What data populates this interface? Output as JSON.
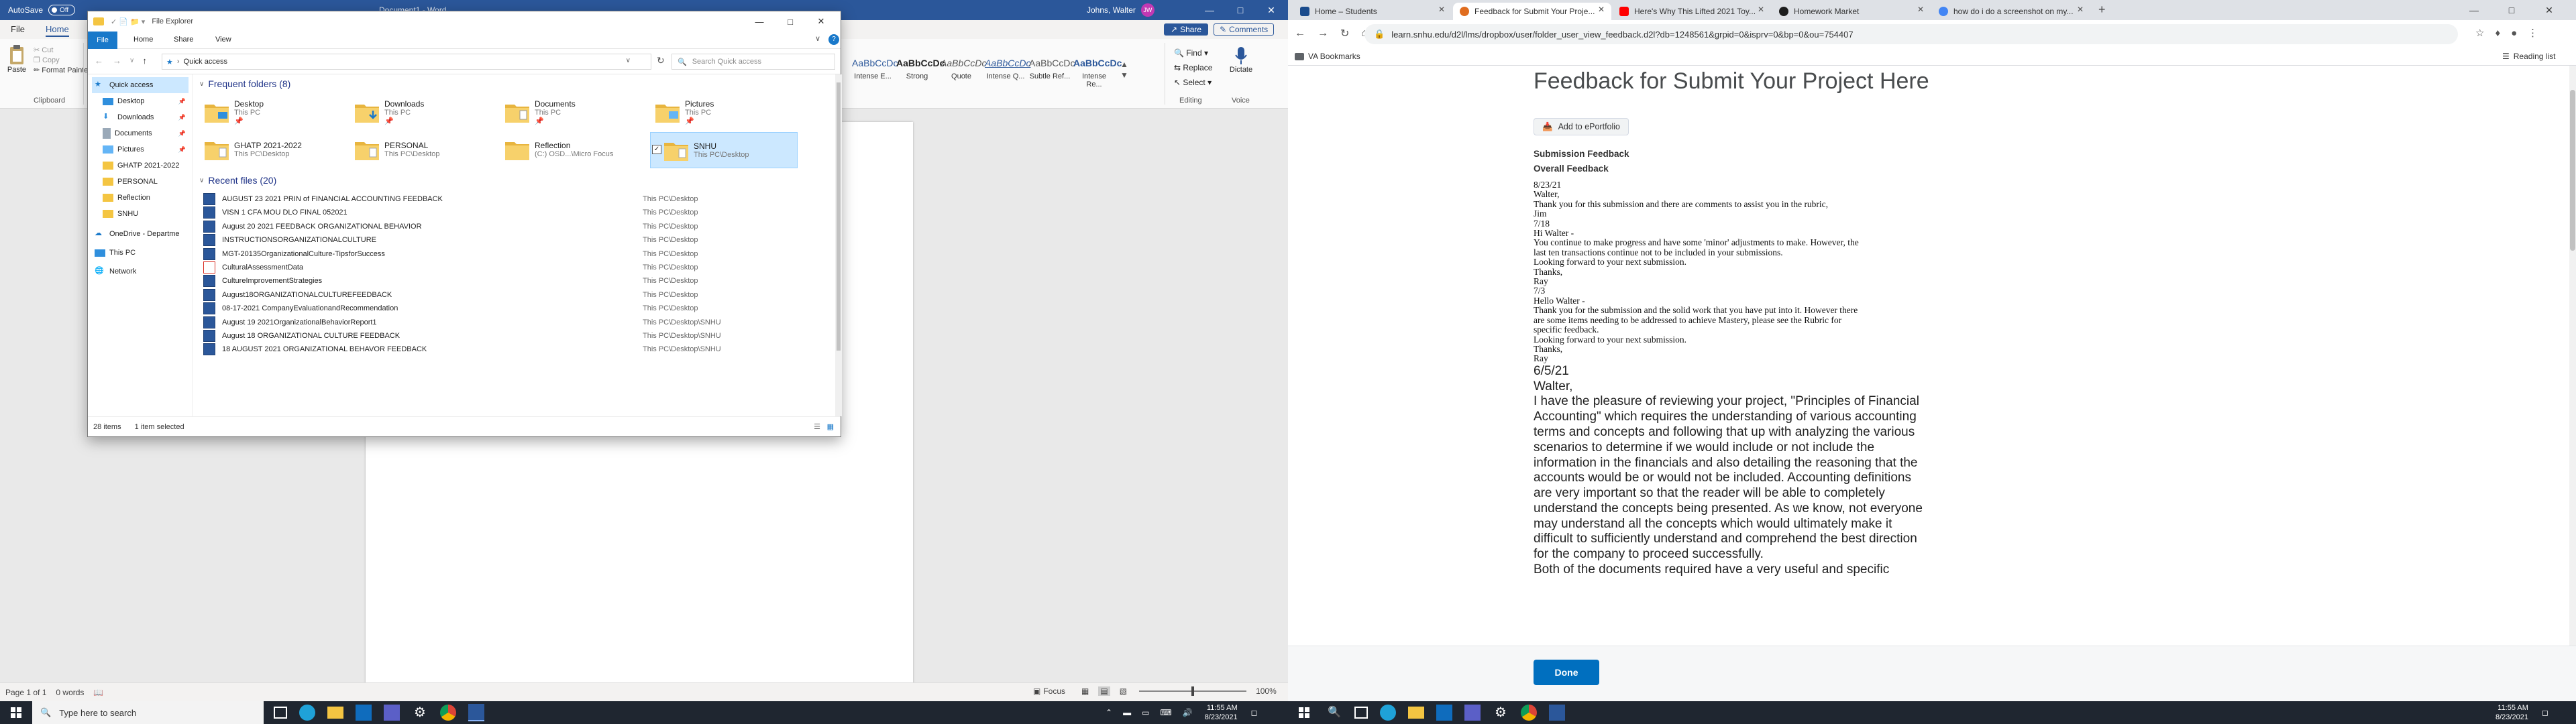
{
  "word": {
    "autosave_label": "AutoSave",
    "autosave_state": "Off",
    "doc_title": "Document1 - Word",
    "user_name": "Johns, Walter",
    "user_initials": "JW",
    "tabs": [
      "File",
      "Home"
    ],
    "share_label": "Share",
    "comments_label": "Comments",
    "clipboard": {
      "paste": "Paste",
      "cut": "Cut",
      "copy": "Copy",
      "format_painter": "Format Painter",
      "group": "Clipboard"
    },
    "styles": [
      {
        "sample": "AaBbCcDc",
        "name": "Intense E..."
      },
      {
        "sample": "AaBbCcDc",
        "name": "Strong"
      },
      {
        "sample": "AaBbCcDc",
        "name": "Quote"
      },
      {
        "sample": "AaBbCcDc",
        "name": "Intense Q..."
      },
      {
        "sample": "AaBbCcDc",
        "name": "Subtle Ref..."
      },
      {
        "sample": "AaBbCcDc",
        "name": "Intense Re..."
      }
    ],
    "editing": {
      "find": "Find",
      "replace": "Replace",
      "select": "Select",
      "group": "Editing"
    },
    "voice": {
      "dictate": "Dictate",
      "group": "Voice"
    },
    "status_page": "Page 1 of 1",
    "status_words": "0 words",
    "status_focus": "Focus",
    "status_zoom": "100%"
  },
  "explorer": {
    "title": "File Explorer",
    "ribbon_tabs": [
      "File",
      "Home",
      "Share",
      "View"
    ],
    "address": "Quick access",
    "search_placeholder": "Search Quick access",
    "sidebar": [
      {
        "label": "Quick access",
        "icon": "star-icon"
      },
      {
        "label": "Desktop",
        "icon": "desktop-icon"
      },
      {
        "label": "Downloads",
        "icon": "download-icon"
      },
      {
        "label": "Documents",
        "icon": "document-icon"
      },
      {
        "label": "Pictures",
        "icon": "picture-icon"
      },
      {
        "label": "GHATP 2021-2022",
        "icon": "folder-icon"
      },
      {
        "label": "PERSONAL",
        "icon": "folder-icon"
      },
      {
        "label": "Reflection",
        "icon": "folder-icon"
      },
      {
        "label": "SNHU",
        "icon": "folder-icon"
      },
      {
        "label": "OneDrive - Departme",
        "icon": "cloud-icon"
      },
      {
        "label": "This PC",
        "icon": "pc-icon"
      },
      {
        "label": "Network",
        "icon": "network-icon"
      }
    ],
    "frequent_header": "Frequent folders (8)",
    "frequent": [
      {
        "name": "Desktop",
        "path": "This PC"
      },
      {
        "name": "Downloads",
        "path": "This PC"
      },
      {
        "name": "Documents",
        "path": "This PC"
      },
      {
        "name": "Pictures",
        "path": "This PC"
      },
      {
        "name": "GHATP 2021-2022",
        "path": "This PC\\Desktop"
      },
      {
        "name": "PERSONAL",
        "path": "This PC\\Desktop"
      },
      {
        "name": "Reflection",
        "path": "(C:) OSD...\\Micro Focus"
      },
      {
        "name": "SNHU",
        "path": "This PC\\Desktop"
      }
    ],
    "recent_header": "Recent files (20)",
    "recent": [
      {
        "name": "AUGUST 23 2021 PRIN of FINANCIAL ACCOUNTING FEEDBACK",
        "loc": "This PC\\Desktop",
        "type": "word"
      },
      {
        "name": "VISN 1 CFA MOU DLO FINAL 052021",
        "loc": "This PC\\Desktop",
        "type": "word"
      },
      {
        "name": "August 20 2021 FEEDBACK ORGANIZATIONAL BEHAVIOR",
        "loc": "This PC\\Desktop",
        "type": "word"
      },
      {
        "name": "INSTRUCTIONSORGANIZATIONALCULTURE",
        "loc": "This PC\\Desktop",
        "type": "word"
      },
      {
        "name": "MGT-20135OrganizationalCulture-TipsforSuccess",
        "loc": "This PC\\Desktop",
        "type": "word"
      },
      {
        "name": "CulturalAssessmentData",
        "loc": "This PC\\Desktop",
        "type": "pdf"
      },
      {
        "name": "CultureImprovementStrategies",
        "loc": "This PC\\Desktop",
        "type": "word"
      },
      {
        "name": "August18ORGANIZATIONALCULTUREFEEDBACK",
        "loc": "This PC\\Desktop",
        "type": "word"
      },
      {
        "name": "08-17-2021 CompanyEvaluationandRecommendation",
        "loc": "This PC\\Desktop",
        "type": "word"
      },
      {
        "name": "August 19 2021OrganizationalBehaviorReport1",
        "loc": "This PC\\Desktop\\SNHU",
        "type": "word"
      },
      {
        "name": "August 18 ORGANIZATIONAL CULTURE FEEDBACK",
        "loc": "This PC\\Desktop\\SNHU",
        "type": "word"
      },
      {
        "name": "18 AUGUST 2021 ORGANIZATIONAL BEHAVOR FEEDBACK",
        "loc": "This PC\\Desktop\\SNHU",
        "type": "word"
      }
    ],
    "status_items": "28 items",
    "status_selected": "1 item selected"
  },
  "taskbar": {
    "search_placeholder": "Type here to search",
    "time": "11:55 AM",
    "date": "8/23/2021"
  },
  "chrome": {
    "tabs": [
      {
        "title": "Home – Students",
        "color": "#1a4b8c"
      },
      {
        "title": "Feedback for Submit Your Proje...",
        "color": "#e06d1f"
      },
      {
        "title": "Here's Why This Lifted 2021 Toy...",
        "color": "#ff0000"
      },
      {
        "title": "Homework Market",
        "color": "#1d1d1d"
      },
      {
        "title": "how do i do a screenshot on my...",
        "color": "#4285f4"
      }
    ],
    "url": "learn.snhu.edu/d2l/lms/dropbox/user/folder_user_view_feedback.d2l?db=1248561&grpid=0&isprv=0&bp=0&ou=754407",
    "bookmark_folder": "VA Bookmarks",
    "reading_list": "Reading list",
    "page_title": "Feedback for Submit Your Project Here",
    "eportfolio_button": "Add to ePortfolio",
    "submission_feedback": "Submission Feedback",
    "overall_feedback": "Overall Feedback",
    "feedback_small": [
      "8/23/21",
      "Walter,",
      "Thank you for this submission and there are comments to assist you in the rubric,",
      "Jim",
      "7/18",
      "Hi Walter -",
      "You continue to make progress and have some 'minor' adjustments to make.  However, the",
      "last ten transactions continue not to be included in your submissions.",
      "Looking forward to your next submission.",
      "Thanks,",
      "Ray",
      "7/3",
      "Hello Walter -",
      "Thank you for the submission and the solid work that you have put into it.  However there",
      "are some items needing to be addressed to achieve Mastery, please see the Rubric for",
      "specific feedback.",
      "Looking forward to your next submission.",
      "Thanks,",
      "Ray"
    ],
    "feedback_large": [
      "6/5/21",
      "Walter,",
      "I have the pleasure of reviewing your project, \"Principles of Financial",
      "Accounting\" which requires the understanding of various accounting",
      "terms and concepts and following that up with analyzing the various",
      "scenarios to determine if we would include or not include the",
      "information in the financials and also detailing the reasoning that the",
      "accounts would be or would not be included.   Accounting definitions",
      "are very important so that the reader will be able to completely",
      "understand the concepts being presented.  As we know, not everyone",
      "may understand all the concepts which would ultimately make it",
      "difficult to sufficiently understand and comprehend the best direction",
      "for the company to proceed successfully.",
      "Both of the documents required have a very useful and specific"
    ],
    "done_button": "Done"
  }
}
